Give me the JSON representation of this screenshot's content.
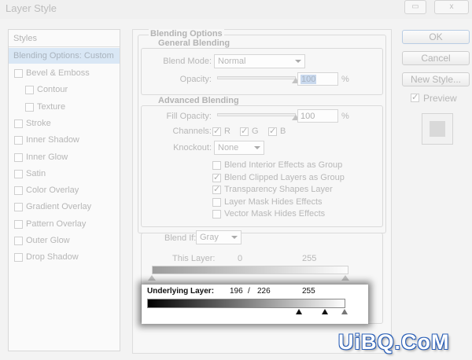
{
  "window": {
    "title": "Layer Style",
    "minimize_glyph": "▭",
    "close_glyph": "x"
  },
  "styles_list": {
    "header": "Styles",
    "selected": "Blending Options: Custom",
    "items": [
      {
        "label": "Bevel & Emboss",
        "checked": false,
        "indent": 0
      },
      {
        "label": "Contour",
        "checked": false,
        "indent": 1
      },
      {
        "label": "Texture",
        "checked": false,
        "indent": 1
      },
      {
        "label": "Stroke",
        "checked": false,
        "indent": 0
      },
      {
        "label": "Inner Shadow",
        "checked": false,
        "indent": 0
      },
      {
        "label": "Inner Glow",
        "checked": false,
        "indent": 0
      },
      {
        "label": "Satin",
        "checked": false,
        "indent": 0
      },
      {
        "label": "Color Overlay",
        "checked": false,
        "indent": 0
      },
      {
        "label": "Gradient Overlay",
        "checked": false,
        "indent": 0
      },
      {
        "label": "Pattern Overlay",
        "checked": false,
        "indent": 0
      },
      {
        "label": "Outer Glow",
        "checked": false,
        "indent": 0
      },
      {
        "label": "Drop Shadow",
        "checked": false,
        "indent": 0
      }
    ]
  },
  "blending_options": {
    "title": "Blending Options",
    "general": {
      "title": "General Blending",
      "blend_mode_label": "Blend Mode:",
      "blend_mode_value": "Normal",
      "opacity_label": "Opacity:",
      "opacity_value": "100",
      "opacity_unit": "%",
      "opacity_level": 1.0
    },
    "advanced": {
      "title": "Advanced Blending",
      "fill_opacity_label": "Fill Opacity:",
      "fill_opacity_value": "100",
      "fill_opacity_unit": "%",
      "fill_opacity_level": 1.0,
      "channels_label": "Channels:",
      "channels": [
        {
          "label": "R",
          "checked": true
        },
        {
          "label": "G",
          "checked": true
        },
        {
          "label": "B",
          "checked": true
        }
      ],
      "knockout_label": "Knockout:",
      "knockout_value": "None",
      "options": [
        {
          "label": "Blend Interior Effects as Group",
          "checked": false
        },
        {
          "label": "Blend Clipped Layers as Group",
          "checked": true
        },
        {
          "label": "Transparency Shapes Layer",
          "checked": true
        },
        {
          "label": "Layer Mask Hides Effects",
          "checked": false
        },
        {
          "label": "Vector Mask Hides Effects",
          "checked": false
        }
      ]
    },
    "blend_if": {
      "label": "Blend If:",
      "value": "Gray",
      "this_layer": {
        "label": "This Layer:",
        "low": "0",
        "high": "255"
      },
      "underlying_layer": {
        "label": "Underlying Layer:",
        "low": "196",
        "separator": "/",
        "mid": "226",
        "high": "255"
      }
    }
  },
  "buttons": {
    "ok": "OK",
    "cancel": "Cancel",
    "new_style": "New Style...",
    "preview": "Preview",
    "preview_checked": true
  },
  "watermark": "UiBQ.CoM"
}
